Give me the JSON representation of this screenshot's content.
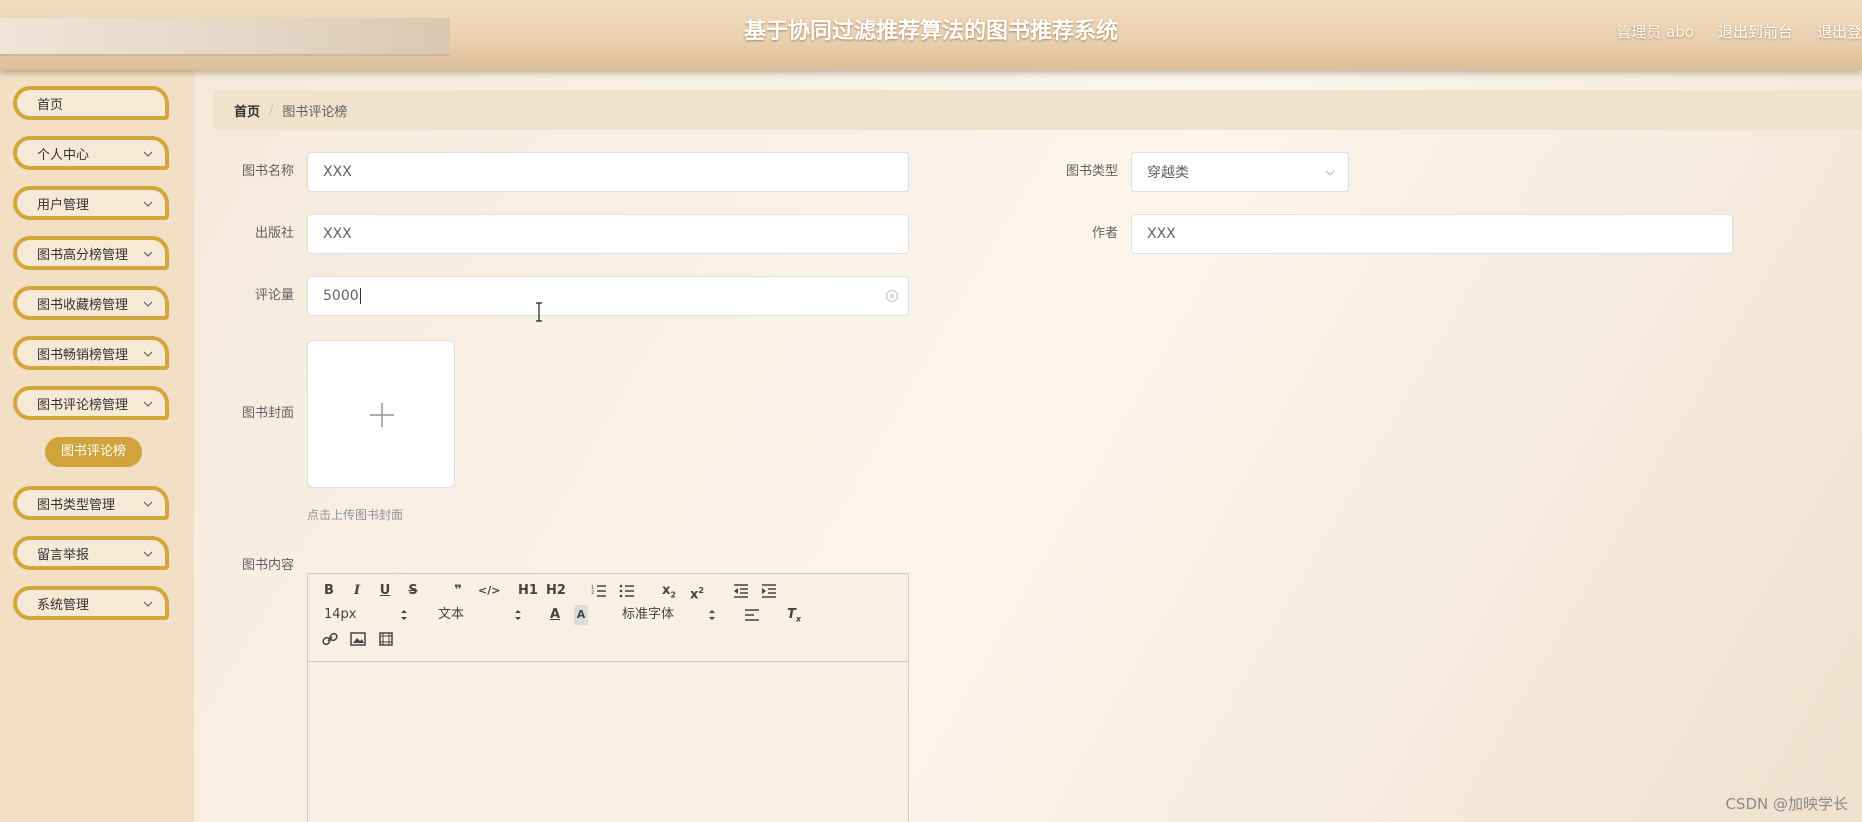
{
  "header": {
    "title": "基于协同过滤推荐算法的图书推荐系统",
    "admin": "管理员 abo",
    "exit_front": "退出到前台",
    "logout": "退出登"
  },
  "sidebar": {
    "items": [
      {
        "label": "首页",
        "has_arrow": false
      },
      {
        "label": "个人中心",
        "has_arrow": true
      },
      {
        "label": "用户管理",
        "has_arrow": true
      },
      {
        "label": "图书高分榜管理",
        "has_arrow": true
      },
      {
        "label": "图书收藏榜管理",
        "has_arrow": true
      },
      {
        "label": "图书畅销榜管理",
        "has_arrow": true
      },
      {
        "label": "图书评论榜管理",
        "has_arrow": true
      },
      {
        "label": "图书类型管理",
        "has_arrow": true
      },
      {
        "label": "留言举报",
        "has_arrow": true
      },
      {
        "label": "系统管理",
        "has_arrow": true
      }
    ],
    "active_sub": "图书评论榜"
  },
  "breadcrumb": {
    "home": "首页",
    "separator": "/",
    "current": "图书评论榜"
  },
  "form": {
    "book_name_label": "图书名称",
    "book_name_value": "XXX",
    "book_type_label": "图书类型",
    "book_type_value": "穿越类",
    "publisher_label": "出版社",
    "publisher_value": "XXX",
    "author_label": "作者",
    "author_value": "XXX",
    "comments_label": "评论量",
    "comments_value": "5000",
    "cover_label": "图书封面",
    "cover_tip": "点击上传图书封面",
    "content_label": "图书内容"
  },
  "editor": {
    "font_size": "14px",
    "header_select": "文本",
    "font_select": "标准字体",
    "h1": "H1",
    "h2": "H2"
  },
  "watermark": "CSDN @加映学长",
  "colors": {
    "accent": "#d4a53a",
    "active_sub": "#d0a33b",
    "sidebar_bg": "#f2dfc4"
  }
}
